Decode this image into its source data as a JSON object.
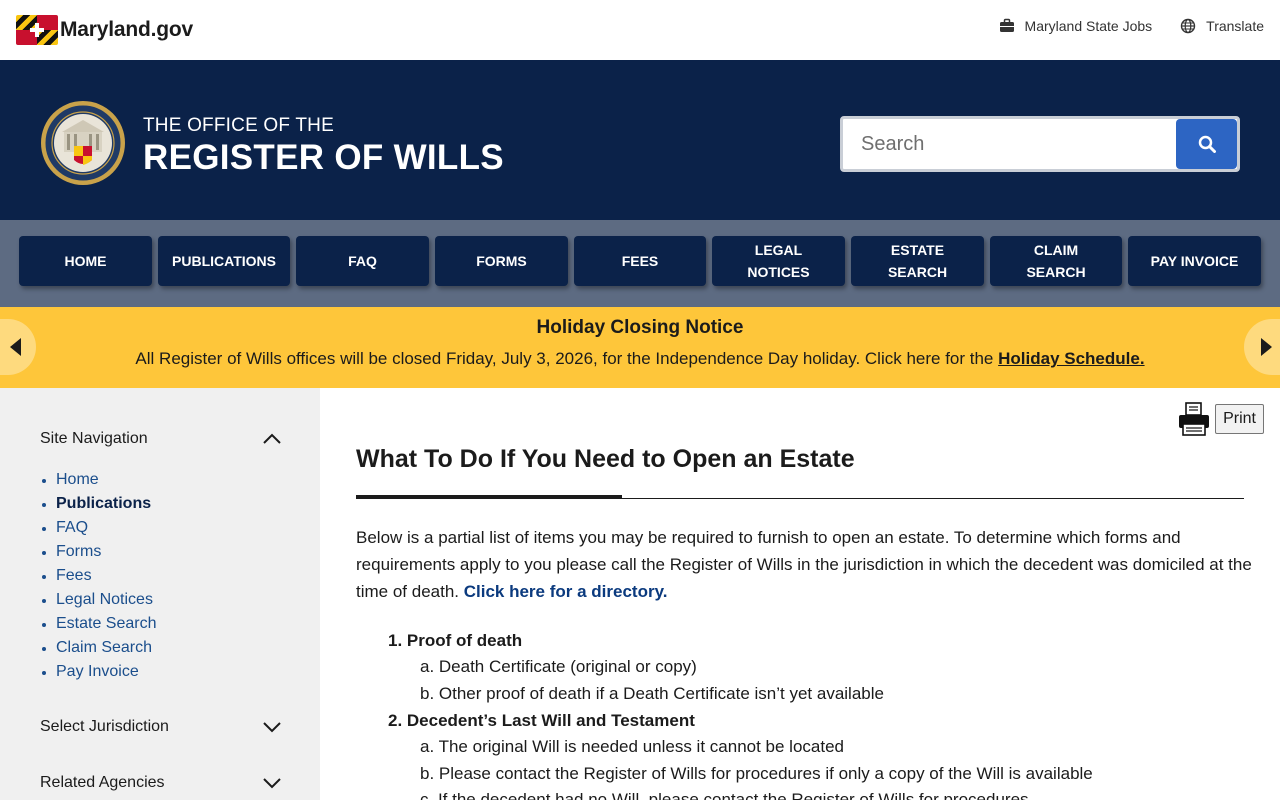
{
  "utility": {
    "logo_text": "Maryland.gov",
    "jobs_label": "Maryland State Jobs",
    "translate_label": "Translate"
  },
  "header": {
    "office_line1": "THE OFFICE OF THE",
    "office_line2": "REGISTER OF WILLS",
    "search_placeholder": "Search"
  },
  "nav": {
    "items": [
      {
        "line1": "HOME",
        "line2": ""
      },
      {
        "line1": "PUBLICATIONS",
        "line2": ""
      },
      {
        "line1": "FAQ",
        "line2": ""
      },
      {
        "line1": "FORMS",
        "line2": ""
      },
      {
        "line1": "FEES",
        "line2": ""
      },
      {
        "line1": "LEGAL",
        "line2": "NOTICES"
      },
      {
        "line1": "ESTATE",
        "line2": "SEARCH"
      },
      {
        "line1": "CLAIM",
        "line2": "SEARCH"
      },
      {
        "line1": "PAY INVOICE",
        "line2": ""
      }
    ]
  },
  "alert": {
    "title": "Holiday Closing Notice",
    "body": "All Register of Wills offices will be closed Friday, July 3, 2026, for the Independence Day holiday. Click here for the ",
    "link": "Holiday Schedule."
  },
  "sidebar": {
    "site_nav_heading": "Site Navigation",
    "items": [
      "Home",
      "Publications",
      "FAQ",
      "Forms",
      "Fees",
      "Legal Notices",
      "Estate Search",
      "Claim Search",
      "Pay Invoice"
    ],
    "active_item": "Publications",
    "select_jurisdiction": "Select Jurisdiction",
    "related_agencies": "Related Agencies"
  },
  "main": {
    "print_label": "Print",
    "title": "What To Do If You Need to Open an Estate",
    "intro": "Below is a partial list of items you may be required to furnish to open an estate. To determine which forms and requirements apply to you please call the Register of Wills in the jurisdiction in which the decedent was domiciled at the time of death. ",
    "intro_link": "Click here for a directory.",
    "steps": [
      {
        "head": "1. Proof of death",
        "subs": [
          "a. Death Certificate (original or copy)",
          "b. Other proof of death if a Death Certificate isn’t yet available"
        ]
      },
      {
        "head": "2. Decedent’s Last Will and Testament",
        "subs": [
          "a. The original Will is needed unless it cannot be located",
          "b. Please contact the Register of Wills for procedures if only a copy of the Will is available",
          "c. If the decedent had no Will, please contact the Register of Wills for procedures"
        ]
      }
    ]
  },
  "colors": {
    "header_navy": "#0b2249",
    "nav_bar": "#5d6b82",
    "alert_yellow": "#fec63a",
    "search_blue": "#2d65c3",
    "sidebar_bg": "#f0f0f0"
  }
}
